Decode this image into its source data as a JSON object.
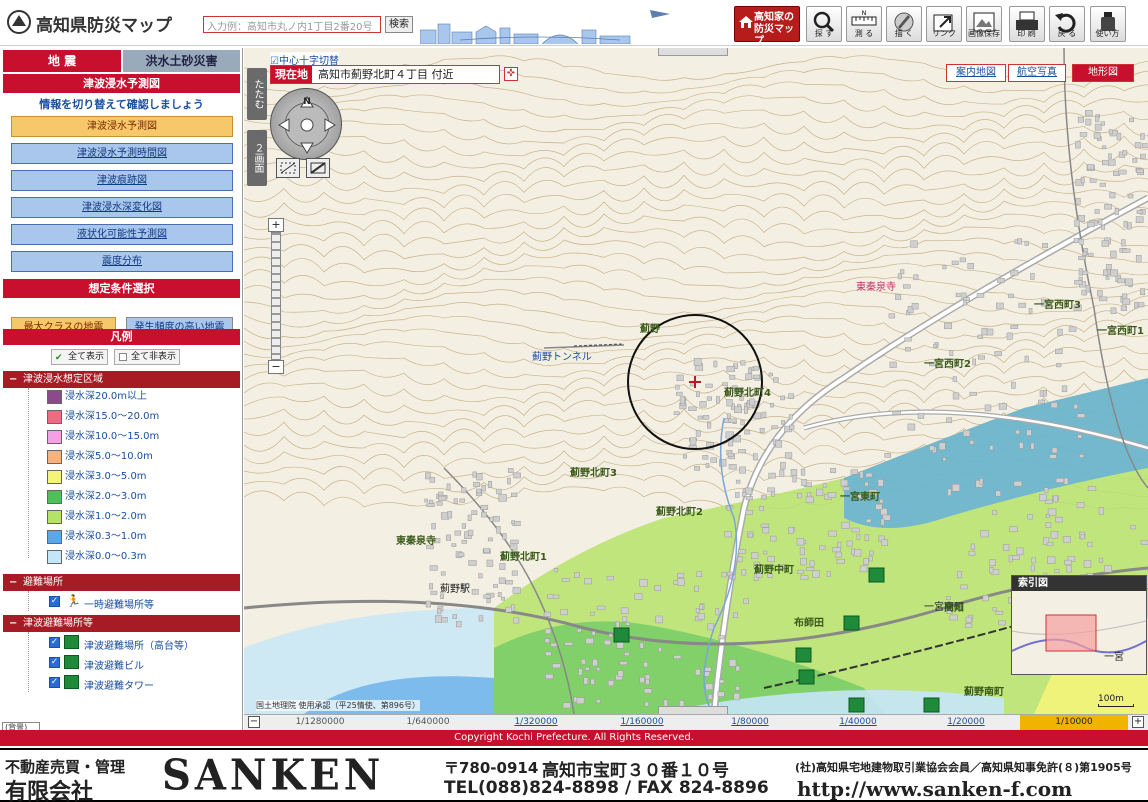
{
  "header": {
    "title": "高知県防災マップ",
    "search_placeholder": "入力例：高知市丸ノ内1丁目2番20号",
    "search_button": "検索",
    "home_button": "高知家の防災マップ",
    "tools": [
      {
        "label": "探 す",
        "icon": "magnifier-icon"
      },
      {
        "label": "測 る",
        "icon": "ruler-icon"
      },
      {
        "label": "描 く",
        "icon": "pen-icon"
      },
      {
        "label": "リンク",
        "icon": "link-arrow-icon"
      },
      {
        "label": "画像保存",
        "icon": "image-save-icon"
      },
      {
        "label": "印 刷",
        "icon": "printer-icon"
      },
      {
        "label": "戻 る",
        "icon": "undo-icon"
      },
      {
        "label": "使い方",
        "icon": "help-bottle-icon"
      }
    ]
  },
  "left": {
    "tabs": [
      "地 震",
      "洪水土砂災害"
    ],
    "section_title": "津波浸水予測図",
    "subtitle": "情報を切り替えて確認しましょう",
    "map_buttons": [
      {
        "label": "津波浸水予測図",
        "selected": true
      },
      {
        "label": "津波浸水予測時間図",
        "selected": false
      },
      {
        "label": "津波痕跡図",
        "selected": false
      },
      {
        "label": "津波浸水深変化図",
        "selected": false
      },
      {
        "label": "液状化可能性予測図",
        "selected": false
      },
      {
        "label": "震度分布",
        "selected": false
      }
    ],
    "scenario_title": "想定条件選択",
    "scenario_buttons": [
      "最大クラスの地震",
      "発生頻度の高い地震"
    ],
    "legend_title": "凡例",
    "show_all": "全て表示",
    "hide_all": "全て非表示",
    "groups": [
      {
        "title": "津波浸水想定区域",
        "items": [
          {
            "label": "浸水深20.0m以上",
            "color": "#8b4a8b"
          },
          {
            "label": "浸水深15.0〜20.0m",
            "color": "#f06a82"
          },
          {
            "label": "浸水深10.0〜15.0m",
            "color": "#f4a0e4"
          },
          {
            "label": "浸水深5.0〜10.0m",
            "color": "#f7b27e"
          },
          {
            "label": "浸水深3.0〜5.0m",
            "color": "#f4f47a"
          },
          {
            "label": "浸水深2.0〜3.0m",
            "color": "#4fbf5a"
          },
          {
            "label": "浸水深1.0〜2.0m",
            "color": "#b5e36a"
          },
          {
            "label": "浸水深0.3〜1.0m",
            "color": "#5aa8e8"
          },
          {
            "label": "浸水深0.0〜0.3m",
            "color": "#c4e6f8"
          }
        ]
      },
      {
        "title": "避難場所",
        "items": [
          {
            "label": "一時避難場所等"
          }
        ]
      },
      {
        "title": "津波避難場所等",
        "items": [
          {
            "label": "津波避難場所（高台等）"
          },
          {
            "label": "津波避難ビル"
          },
          {
            "label": "津波避難タワー"
          }
        ]
      }
    ],
    "note": "(背景)\n¥ (入"
  },
  "map": {
    "center_toggle": "中心十字切替",
    "current_label": "現在地",
    "current_value": "高知市薊野北町４丁目 付近",
    "fold_labels": [
      "たたむ",
      "２画面"
    ],
    "map_types": [
      {
        "label": "案内地図",
        "selected": false
      },
      {
        "label": "航空写真",
        "selected": false
      },
      {
        "label": "地形図",
        "selected": true
      }
    ],
    "labels": [
      "薊野",
      "薊野北町4",
      "薊野北町3",
      "薊野北町2",
      "薊野北町1",
      "薊野トンネル",
      "東秦泉寺",
      "一宮西町3",
      "一宮西町2",
      "一宮西町1",
      "一宮東町",
      "一宮南町",
      "薊野中町",
      "薊野南町",
      "一宮",
      "布師田",
      "薊野駅",
      "東秦泉寺",
      "高知",
      "宮西町"
    ],
    "overview_title": "索引図",
    "scale_label": "100m",
    "credit": "国土地理院 使用承認（平25情使、第896号）"
  },
  "scales": [
    {
      "label": "1/1280000",
      "link": false,
      "selected": false
    },
    {
      "label": "1/640000",
      "link": false,
      "selected": false
    },
    {
      "label": "1/320000",
      "link": true,
      "selected": false
    },
    {
      "label": "1/160000",
      "link": true,
      "selected": false
    },
    {
      "label": "1/80000",
      "link": true,
      "selected": false
    },
    {
      "label": "1/40000",
      "link": true,
      "selected": false
    },
    {
      "label": "1/20000",
      "link": true,
      "selected": false
    },
    {
      "label": "1/10000",
      "link": false,
      "selected": true
    }
  ],
  "copyright": "Copyright Kochi Prefecture. All Rights Reserved.",
  "footer": {
    "line1": "不動産売買・管理",
    "line2": "有限会社",
    "brand": "SANKEN",
    "zip": "〒780-0914",
    "address": "高知市宝町３０番１０号",
    "tel": "TEL(088)824-8898 / FAX 824-8896",
    "license": "(社)高知県宅地建物取引業協会会員／高知県知事免許(８)第1905号",
    "url": "http://www.sanken-f.com"
  }
}
